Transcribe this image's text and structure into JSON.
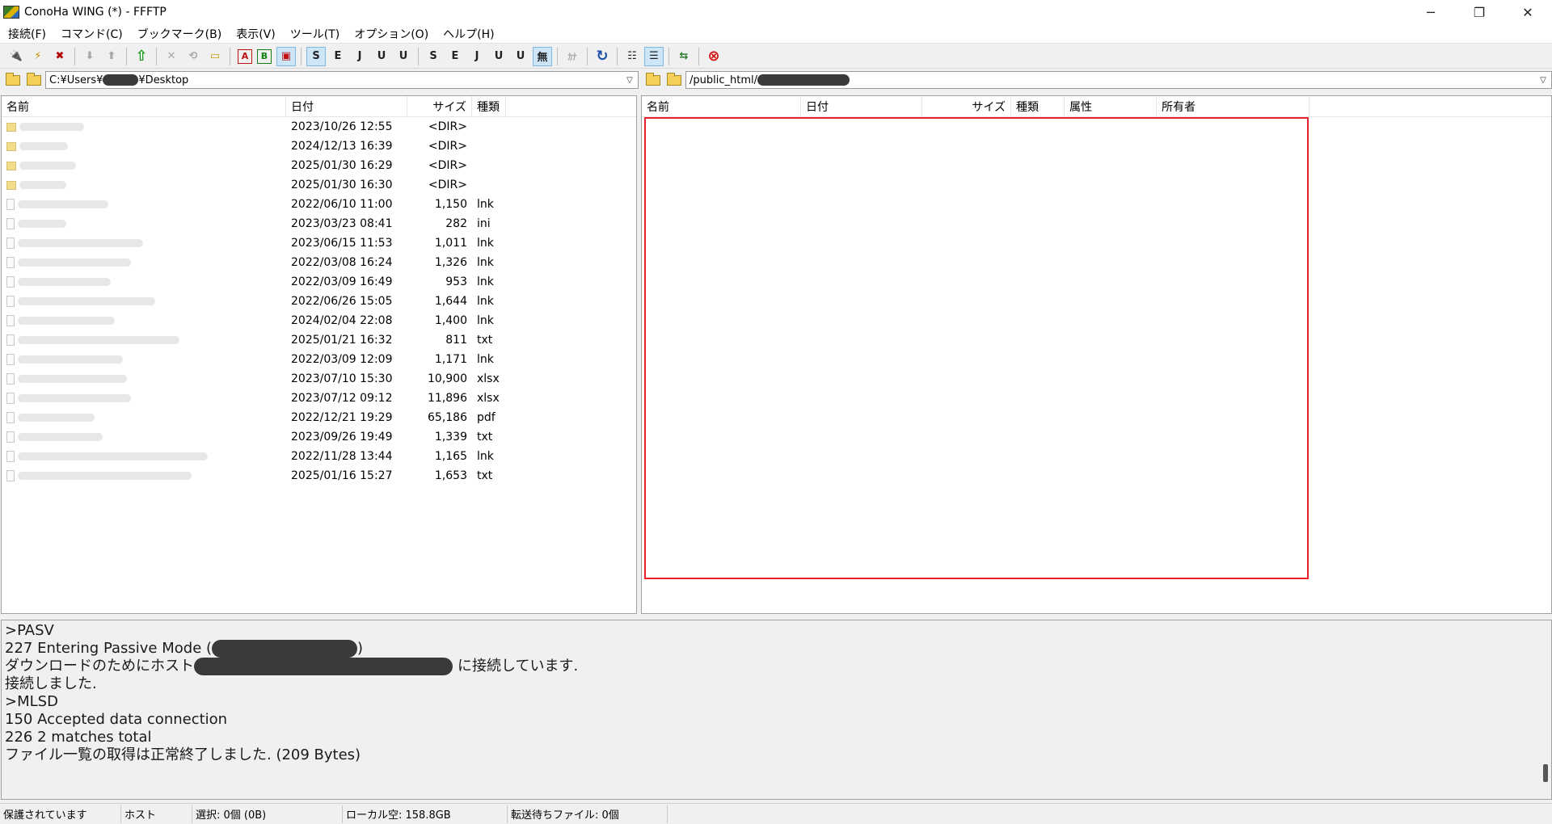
{
  "window": {
    "title": "ConoHa WING (*) - FFFTP",
    "minimize": "─",
    "maximize": "❐",
    "close": "✕"
  },
  "menu": [
    "接続(F)",
    "コマンド(C)",
    "ブックマーク(B)",
    "表示(V)",
    "ツール(T)",
    "オプション(O)",
    "ヘルプ(H)"
  ],
  "local": {
    "path_prefix": "C:¥Users¥",
    "path_suffix": "¥Desktop",
    "columns": [
      "名前",
      "日付",
      "サイズ",
      "種類"
    ],
    "files": [
      {
        "date": "2023/10/26 12:55",
        "size": "<DIR>",
        "type": "",
        "dir": true
      },
      {
        "date": "2024/12/13 16:39",
        "size": "<DIR>",
        "type": "",
        "dir": true
      },
      {
        "date": "2025/01/30 16:29",
        "size": "<DIR>",
        "type": "",
        "dir": true
      },
      {
        "date": "2025/01/30 16:30",
        "size": "<DIR>",
        "type": "",
        "dir": true
      },
      {
        "date": "2022/06/10 11:00",
        "size": "1,150",
        "type": "lnk"
      },
      {
        "date": "2023/03/23 08:41",
        "size": "282",
        "type": "ini"
      },
      {
        "date": "2023/06/15 11:53",
        "size": "1,011",
        "type": "lnk"
      },
      {
        "date": "2022/03/08 16:24",
        "size": "1,326",
        "type": "lnk"
      },
      {
        "date": "2022/03/09 16:49",
        "size": "953",
        "type": "lnk"
      },
      {
        "date": "2022/06/26 15:05",
        "size": "1,644",
        "type": "lnk"
      },
      {
        "date": "2024/02/04 22:08",
        "size": "1,400",
        "type": "lnk"
      },
      {
        "date": "2025/01/21 16:32",
        "size": "811",
        "type": "txt"
      },
      {
        "date": "2022/03/09 12:09",
        "size": "1,171",
        "type": "lnk"
      },
      {
        "date": "2023/07/10 15:30",
        "size": "10,900",
        "type": "xlsx"
      },
      {
        "date": "2023/07/12 09:12",
        "size": "11,896",
        "type": "xlsx"
      },
      {
        "date": "2022/12/21 19:29",
        "size": "65,186",
        "type": "pdf"
      },
      {
        "date": "2023/09/26 19:49",
        "size": "1,339",
        "type": "txt"
      },
      {
        "date": "2022/11/28 13:44",
        "size": "1,165",
        "type": "lnk"
      },
      {
        "date": "2025/01/16 15:27",
        "size": "1,653",
        "type": "txt"
      }
    ]
  },
  "remote": {
    "path_prefix": "/public_html/",
    "columns": [
      "名前",
      "日付",
      "サイズ",
      "種類",
      "属性",
      "所有者"
    ]
  },
  "log": {
    "l1": ">PASV",
    "l2a": "227 Entering Passive Mode (",
    "l2b": ")",
    "l3a": "ダウンロードのためにホスト",
    "l3b": "に接続しています.",
    "l4": "接続しました.",
    "l5": ">MLSD",
    "l6": "150 Accepted data connection",
    "l7": "226 2 matches total",
    "l8": "ファイル一覧の取得は正常終了しました. (209 Bytes)"
  },
  "status": {
    "protect": "保護されています",
    "host": "ホスト",
    "selected": "選択: 0個 (0B)",
    "local_free": "ローカル空: 158.8GB",
    "queue": "転送待ちファイル: 0個"
  },
  "toolbar": {
    "connect": "🔌",
    "quick_connect": "⚡",
    "disconnect": "✖",
    "download": "⬇",
    "upload": "⬆",
    "mirror_upload": "⇧",
    "delete": "✕",
    "rename": "⟲",
    "mkdir": "▭",
    "ascii": "A",
    "binary": "B",
    "auto": "▣",
    "sjis_host": "S",
    "euc_host": "E",
    "jis_host": "J",
    "utf8n_host": "U",
    "utf8_host": "U",
    "sjis_local": "S",
    "euc_local": "E",
    "jis_local": "J",
    "utf8n_local": "U",
    "utf8_local": "U",
    "no_convert": "無",
    "kana": "ｶﾅ",
    "refresh": "↻",
    "list_view": "☷",
    "detail_view": "☰",
    "sync": "⇆",
    "stop": "⊗"
  }
}
